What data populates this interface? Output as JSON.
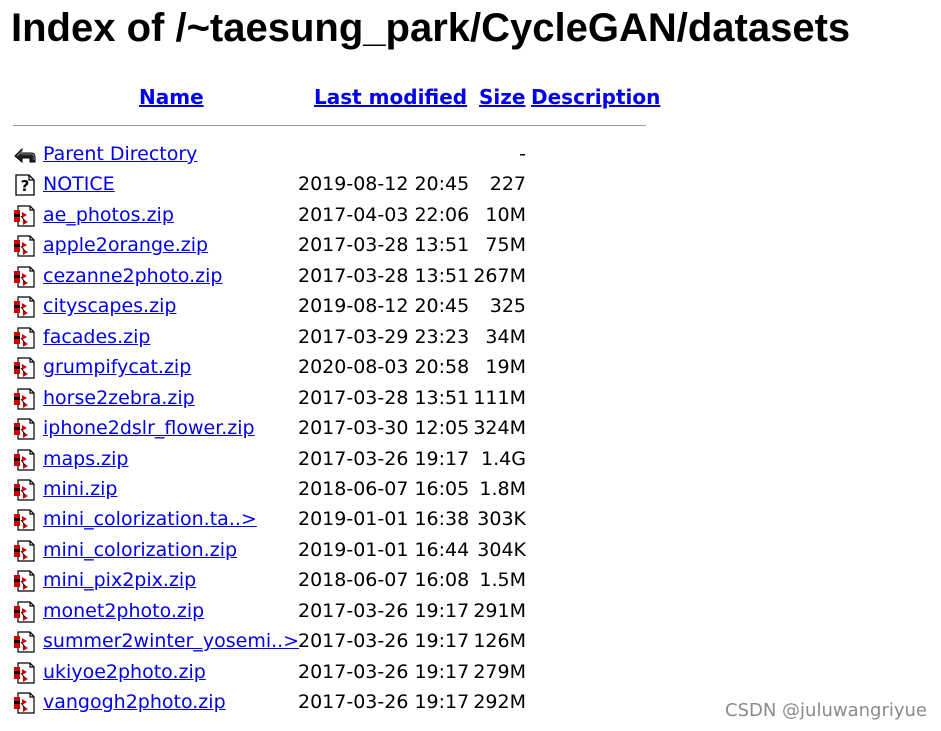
{
  "title": "Index of /~taesung_park/CycleGAN/datasets",
  "headers": {
    "name": "Name",
    "last_modified": "Last modified",
    "size": "Size",
    "description": "Description"
  },
  "rows": [
    {
      "icon": "back",
      "name": "Parent Directory",
      "date": "",
      "size": "-"
    },
    {
      "icon": "unknown",
      "name": "NOTICE",
      "date": "2019-08-12 20:45",
      "size": "227"
    },
    {
      "icon": "compressed",
      "name": "ae_photos.zip",
      "date": "2017-04-03 22:06",
      "size": "10M"
    },
    {
      "icon": "compressed",
      "name": "apple2orange.zip",
      "date": "2017-03-28 13:51",
      "size": "75M"
    },
    {
      "icon": "compressed",
      "name": "cezanne2photo.zip",
      "date": "2017-03-28 13:51",
      "size": "267M"
    },
    {
      "icon": "compressed",
      "name": "cityscapes.zip",
      "date": "2019-08-12 20:45",
      "size": "325"
    },
    {
      "icon": "compressed",
      "name": "facades.zip",
      "date": "2017-03-29 23:23",
      "size": "34M"
    },
    {
      "icon": "compressed",
      "name": "grumpifycat.zip",
      "date": "2020-08-03 20:58",
      "size": "19M"
    },
    {
      "icon": "compressed",
      "name": "horse2zebra.zip",
      "date": "2017-03-28 13:51",
      "size": "111M"
    },
    {
      "icon": "compressed",
      "name": "iphone2dslr_flower.zip",
      "date": "2017-03-30 12:05",
      "size": "324M"
    },
    {
      "icon": "compressed",
      "name": "maps.zip",
      "date": "2017-03-26 19:17",
      "size": "1.4G"
    },
    {
      "icon": "compressed",
      "name": "mini.zip",
      "date": "2018-06-07 16:05",
      "size": "1.8M"
    },
    {
      "icon": "compressed",
      "name": "mini_colorization.ta..>",
      "date": "2019-01-01 16:38",
      "size": "303K"
    },
    {
      "icon": "compressed",
      "name": "mini_colorization.zip",
      "date": "2019-01-01 16:44",
      "size": "304K"
    },
    {
      "icon": "compressed",
      "name": "mini_pix2pix.zip",
      "date": "2018-06-07 16:08",
      "size": "1.5M"
    },
    {
      "icon": "compressed",
      "name": "monet2photo.zip",
      "date": "2017-03-26 19:17",
      "size": "291M"
    },
    {
      "icon": "compressed",
      "name": "summer2winter_yosemi..>",
      "date": "2017-03-26 19:17",
      "size": "126M"
    },
    {
      "icon": "compressed",
      "name": "ukiyoe2photo.zip",
      "date": "2017-03-26 19:17",
      "size": "279M"
    },
    {
      "icon": "compressed",
      "name": "vangogh2photo.zip",
      "date": "2017-03-26 19:17",
      "size": "292M"
    }
  ],
  "watermark": "CSDN @juluwangriyue",
  "colors": {
    "link": "#0000ee",
    "rule": "#9c9c9c",
    "watermark": "#8a8a8a"
  }
}
